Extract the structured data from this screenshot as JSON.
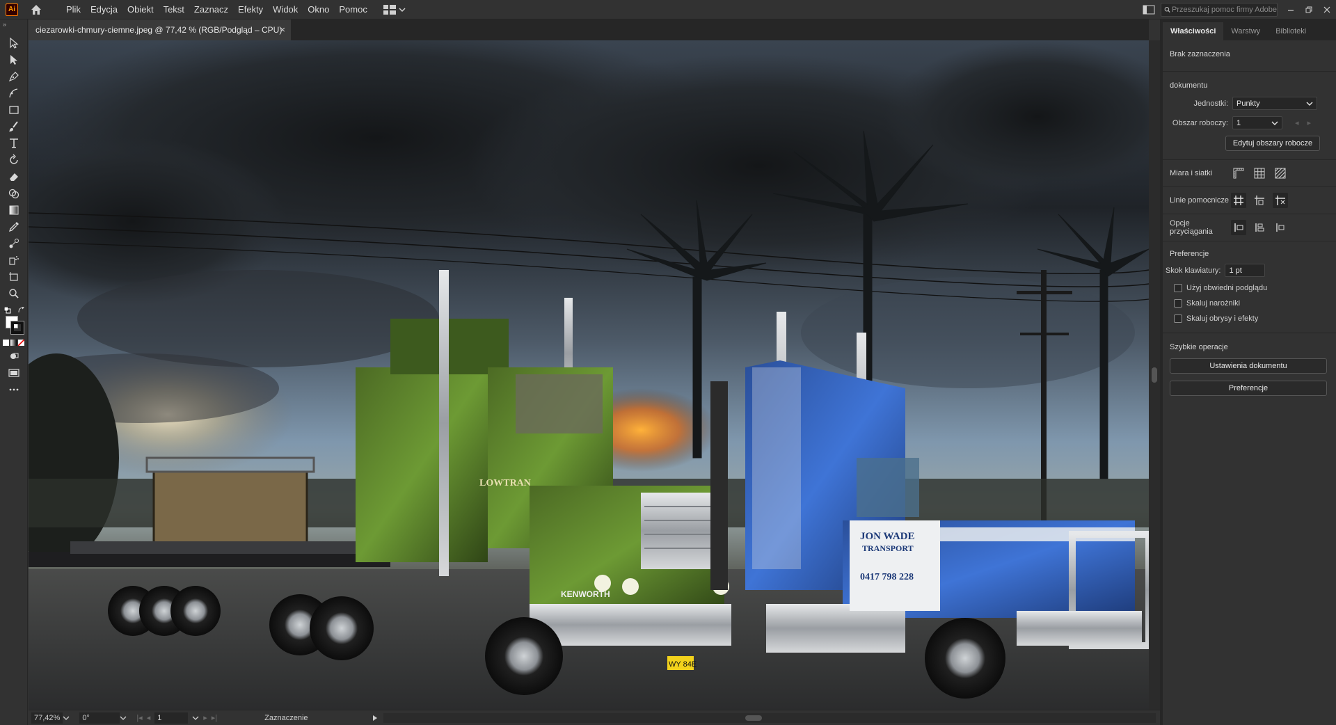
{
  "menubar": {
    "app_logo": "Ai",
    "items": [
      "Plik",
      "Edycja",
      "Obiekt",
      "Tekst",
      "Zaznacz",
      "Efekty",
      "Widok",
      "Okno",
      "Pomoc"
    ],
    "search_placeholder": "Przeszukaj pomoc firmy Adobe"
  },
  "document": {
    "tab_title": "ciezarowki-chmury-ciemne.jpeg @ 77,42 % (RGB/Podgląd – CPU)",
    "close": "×"
  },
  "artwork": {
    "green_truck": {
      "brand": "KENWORTH",
      "name": "LOWTRAN",
      "plate": "WY 84E"
    },
    "blue_truck": {
      "company_line1": "JON WADE",
      "company_line2": "TRANSPORT",
      "phone": "0417 798 228"
    }
  },
  "statusbar": {
    "zoom": "77,42%",
    "rotation": "0°",
    "artboard": "1",
    "tool": "Zaznaczenie"
  },
  "panel": {
    "tabs": [
      "Właściwości",
      "Warstwy",
      "Biblioteki"
    ],
    "no_selection": "Brak zaznaczenia",
    "document_section": "dokumentu",
    "units_label": "Jednostki:",
    "units_value": "Punkty",
    "artboard_label": "Obszar roboczy:",
    "artboard_value": "1",
    "edit_artboards": "Edytuj obszary robocze",
    "rulers_grids": "Miara i siatki",
    "guides": "Linie pomocnicze",
    "snap_options": "Opcje przyciągania",
    "preferences_section": "Preferencje",
    "keyboard_increment_label": "Skok klawiatury:",
    "keyboard_increment_value": "1 pt",
    "checkbox_preview_bounds": "Użyj obwiedni podglądu",
    "checkbox_scale_corners": "Skaluj narożniki",
    "checkbox_scale_strokes": "Skaluj obrysy i efekty",
    "quick_actions": "Szybkie operacje",
    "doc_setup_button": "Ustawienia dokumentu",
    "preferences_button": "Preferencje"
  },
  "colors": {
    "accent": "#ff7c00",
    "bg": "#323232",
    "dark": "#262626"
  }
}
